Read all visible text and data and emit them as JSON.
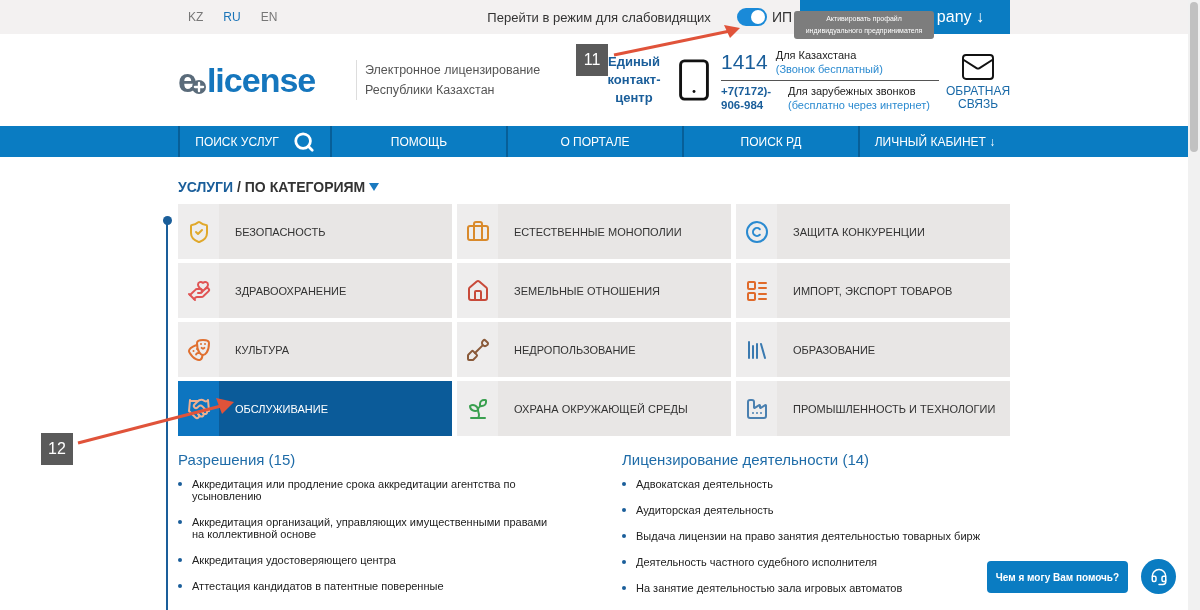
{
  "top_bar": {
    "languages": [
      {
        "label": "KZ",
        "selected": false
      },
      {
        "label": "RU",
        "selected": true
      },
      {
        "label": "EN",
        "selected": false
      }
    ],
    "accessibility_link": "Перейти в режим для слабовидящих",
    "profile_toggle": {
      "label": "ИП",
      "on": true
    },
    "account_button": "pany ↓",
    "tooltip": "Активировать профайл индивидуального предпринимателя"
  },
  "header": {
    "logo": {
      "prefix": "e",
      "name": "license"
    },
    "tagline": "Электронное лицензирование Республики Казахстан",
    "contact_center": "Единый контакт-центр",
    "local_number": "1414",
    "local_label": "Для Казахстана",
    "local_note": "(Звонок бесплатный)",
    "intl_number": "+7(7172)-906-984",
    "intl_label": "Для зарубежных звонков",
    "intl_note": "(бесплатно через интернет)",
    "feedback": "ОБРАТНАЯ СВЯЗЬ"
  },
  "nav": [
    {
      "label": "ПОИСК УСЛУГ",
      "kind": "search"
    },
    {
      "label": "ПОМОЩЬ",
      "kind": "link"
    },
    {
      "label": "О ПОРТАЛЕ",
      "kind": "link"
    },
    {
      "label": "ПОИСК РД",
      "kind": "link"
    },
    {
      "label": "ЛИЧНЫЙ КАБИНЕТ ↓",
      "kind": "link"
    }
  ],
  "section_title": {
    "main": "УСЛУГИ",
    "sub": "/ ПО КАТЕГОРИЯМ"
  },
  "categories": [
    {
      "label": "БЕЗОПАСНОСТЬ",
      "kind": "shield",
      "selected": false
    },
    {
      "label": "ЕСТЕСТВЕННЫЕ МОНОПОЛИИ",
      "kind": "briefcase",
      "selected": false
    },
    {
      "label": "ЗАЩИТА КОНКУРЕНЦИИ",
      "kind": "copyright",
      "selected": false
    },
    {
      "label": "ЗДРАВООХРАНЕНИЕ",
      "kind": "health",
      "selected": false
    },
    {
      "label": "ЗЕМЕЛЬНЫЕ ОТНОШЕНИЯ",
      "kind": "house",
      "selected": false
    },
    {
      "label": "ИМПОРТ, ЭКСПОРТ ТОВАРОВ",
      "kind": "chart",
      "selected": false
    },
    {
      "label": "КУЛЬТУРА",
      "kind": "masks",
      "selected": false
    },
    {
      "label": "НЕДРОПОЛЬЗОВАНИЕ",
      "kind": "shovel",
      "selected": false
    },
    {
      "label": "ОБРАЗОВАНИЕ",
      "kind": "books",
      "selected": false
    },
    {
      "label": "ОБСЛУЖИВАНИЕ",
      "kind": "handshake",
      "selected": true
    },
    {
      "label": "ОХРАНА ОКРУЖАЮЩЕЙ СРЕДЫ",
      "kind": "sprout",
      "selected": false
    },
    {
      "label": "ПРОМЫШЛЕННОСТЬ И ТЕХНОЛОГИИ",
      "kind": "factory",
      "selected": false
    }
  ],
  "lists": [
    {
      "title": "Разрешения (15)",
      "items": [
        "Аккредитация или продление срока аккредитации агентства по усыновлению",
        "Аккредитация организаций, управляющих имущественными правами на коллективной основе",
        "Аккредитация удостоверяющего центра",
        "Аттестация кандидатов в патентные поверенные"
      ]
    },
    {
      "title": "Лицензирование деятельности (14)",
      "items": [
        "Адвокатская деятельность",
        "Аудиторская деятельность",
        "Выдача лицензии на право занятия деятельностью товарных бирж",
        "Деятельность частного судебного исполнителя",
        "На занятие деятельностью зала игровых автоматов"
      ]
    }
  ],
  "chat": {
    "label": "Чем я могу Вам помочь?"
  },
  "annotations": [
    {
      "label": "11"
    },
    {
      "label": "12"
    }
  ]
}
